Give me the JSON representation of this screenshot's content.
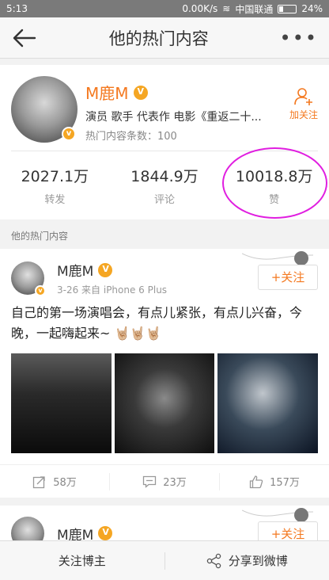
{
  "status_bar": {
    "time": "5:13",
    "network_speed": "0.00K/s",
    "carrier": "中国联通",
    "battery": "24%"
  },
  "nav": {
    "title": "他的热门内容",
    "more": "•••"
  },
  "profile": {
    "name": "M鹿M",
    "description": "演员 歌手 代表作 电影《重返二十...",
    "hot_count_label": "热门内容条数：100",
    "follow_label": "加关注"
  },
  "stats": [
    {
      "value": "2027.1万",
      "label": "转发"
    },
    {
      "value": "1844.9万",
      "label": "评论"
    },
    {
      "value": "10018.8万",
      "label": "赞"
    }
  ],
  "section_title": "他的热门内容",
  "posts": [
    {
      "user": "M鹿M",
      "meta": "3-26  来自 iPhone 6 Plus",
      "follow": "+关注",
      "text": "自己的第一场演唱会，有点儿紧张，有点儿兴奋，今晚，一起嗨起来~ 🤘🏼🤘🏼🤘🏼",
      "actions": {
        "repost": "58万",
        "comment": "23万",
        "like": "157万"
      }
    },
    {
      "user": "M鹿M",
      "follow": "+关注"
    }
  ],
  "bottom_bar": {
    "follow": "关注博主",
    "share": "分享到微博"
  },
  "colors": {
    "accent": "#f47920",
    "highlight_circle": "#e01ee0"
  }
}
